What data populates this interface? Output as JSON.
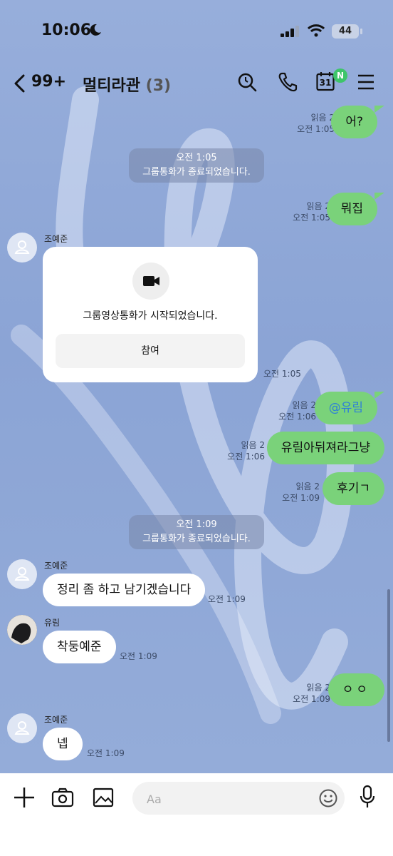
{
  "status": {
    "time": "10:06",
    "battery": "44"
  },
  "header": {
    "unread": "99+",
    "title": "멀티라관",
    "count": "(3)",
    "calendar_day": "31",
    "badge": "N"
  },
  "messages": {
    "m1": {
      "text": "어?",
      "read": "읽음 2",
      "time": "오전 1:05"
    },
    "sys1": {
      "time": "오전 1:05",
      "text": "그룹통화가 종료되었습니다."
    },
    "m2": {
      "text": "뭐집",
      "read": "읽음 2",
      "time": "오전 1:05"
    },
    "sender1": "조예준",
    "card": {
      "text": "그룹영상통화가 시작되었습니다.",
      "button": "참여",
      "time": "오전 1:05"
    },
    "m3": {
      "text": "@유림",
      "read": "읽음 2",
      "time": "오전 1:06"
    },
    "m4": {
      "text": "유림아뒤져라그냥",
      "read": "읽음 2",
      "time": "오전 1:06"
    },
    "m5": {
      "text": "후기ㄱ",
      "read": "읽음 2",
      "time": "오전 1:09"
    },
    "sys2": {
      "time": "오전 1:09",
      "text": "그룹통화가 종료되었습니다."
    },
    "sender2": "조예준",
    "m6": {
      "text": "정리 좀 하고 남기겠습니다",
      "time": "오전 1:09"
    },
    "sender3": "유림",
    "m7": {
      "text": "착둥예준",
      "time": "오전 1:09"
    },
    "m8": {
      "text": "ㅇㅇ",
      "read": "읽음 2",
      "time": "오전 1:09"
    },
    "sender4": "조예준",
    "m9": {
      "text": "넵",
      "time": "오전 1:09"
    }
  },
  "input": {
    "placeholder": "Aa"
  },
  "colors": {
    "chat_bg": "#8ea7d6",
    "my_bubble": "#7ad27a",
    "mention": "#2f7fd8",
    "badge": "#3ec56a"
  }
}
